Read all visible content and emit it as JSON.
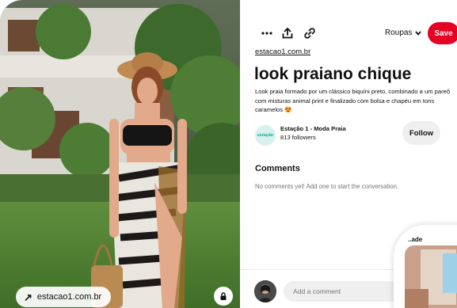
{
  "photo": {
    "source_chip_label": "estacao1.com.br",
    "source_chip_icon": "arrow-up-right-icon",
    "lock_icon": "lock-icon"
  },
  "toolbar": {
    "more_icon": "more-dots-icon",
    "share_icon": "share-upload-icon",
    "link_icon": "link-icon",
    "board_label": "Roupas",
    "board_chevron": "chevron-down-icon",
    "save_label": "Save",
    "save_color": "#e60023"
  },
  "pin": {
    "source_link": "estacao1.com.br",
    "title": "look praiano chique",
    "description": "Look praia formado por um clássico biquíni preto, combinado a um pareô com misturas animal print e finalizado com bolsa e chapéu em tons caramelos 😍"
  },
  "creator": {
    "avatar_text": "estação",
    "name": "Estação 1 - Moda Praia",
    "followers": "813 followers",
    "follow_label": "Follow"
  },
  "comments": {
    "heading": "Comments",
    "empty_text": "No comments yet! Add one to start the conversation.",
    "input_placeholder": "Add a comment"
  },
  "overlay": {
    "text": "..ade"
  }
}
